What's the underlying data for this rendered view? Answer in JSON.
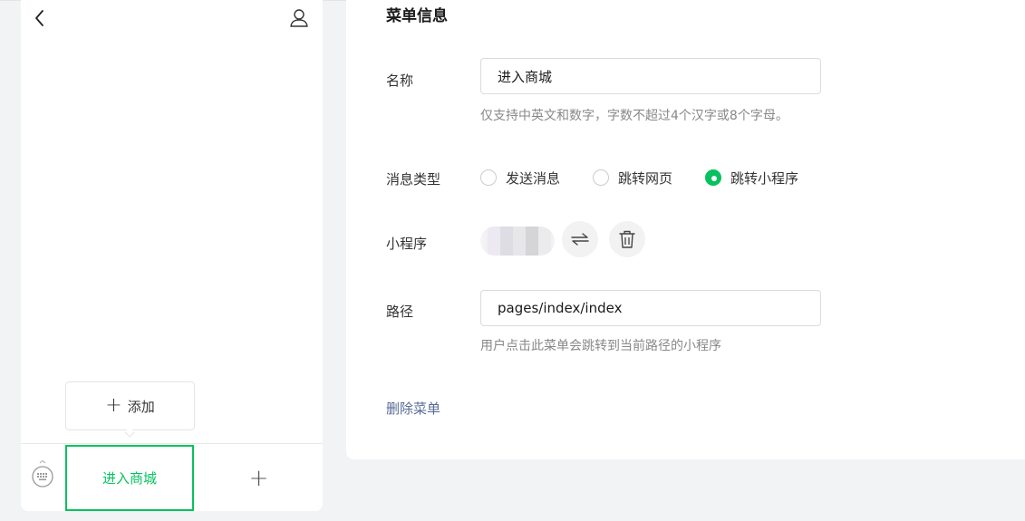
{
  "preview": {
    "menu_button_label": "进入商城",
    "add_popup_label": "添加",
    "plus_symbol": "+"
  },
  "panel": {
    "title": "菜单信息",
    "name_field": {
      "label": "名称",
      "value": "进入商城",
      "hint": "仅支持中英文和数字，字数不超过4个汉字或8个字母。"
    },
    "message_type": {
      "label": "消息类型",
      "options": [
        {
          "label": "发送消息",
          "checked": false
        },
        {
          "label": "跳转网页",
          "checked": false
        },
        {
          "label": "跳转小程序",
          "checked": true
        }
      ]
    },
    "mini_program": {
      "label": "小程序"
    },
    "path_field": {
      "label": "路径",
      "value": "pages/index/index",
      "hint": "用户点击此菜单会跳转到当前路径的小程序"
    },
    "delete_label": "删除菜单"
  },
  "icons": {
    "back": "chevron-left-icon",
    "user": "user-icon",
    "keyboard": "keyboard-icon",
    "swap": "swap-icon",
    "trash": "trash-icon"
  },
  "colors": {
    "accent": "#07c160",
    "link": "#576b95",
    "hint": "#888888"
  }
}
